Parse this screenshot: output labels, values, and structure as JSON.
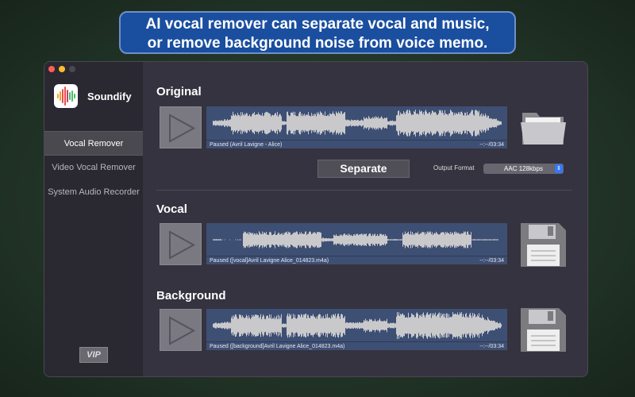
{
  "banner": {
    "line1": "AI vocal remover can separate vocal and music,",
    "line2": "or remove background noise from voice memo."
  },
  "app": {
    "name": "Soundify"
  },
  "sidebar": {
    "items": [
      {
        "label": "Vocal Remover",
        "selected": true
      },
      {
        "label": "Video Vocal Remover"
      },
      {
        "label": "System Audio Recorder"
      }
    ],
    "vip": "VIP"
  },
  "original": {
    "title": "Original",
    "status": "Paused (Avril Lavigne - Alice)",
    "time": "--:--/03:34"
  },
  "controls": {
    "separate": "Separate",
    "output_format_label": "Output Format",
    "output_format": "AAC 128kbps"
  },
  "vocal": {
    "title": "Vocal",
    "status": "Paused ([vocal]Avril Lavigne  Alice_014823.m4a)",
    "time": "--:--/03:34"
  },
  "background": {
    "title": "Background",
    "status": "Paused ([background]Avril Lavigne  Alice_014823.m4a)",
    "time": "--:--/03:34"
  }
}
